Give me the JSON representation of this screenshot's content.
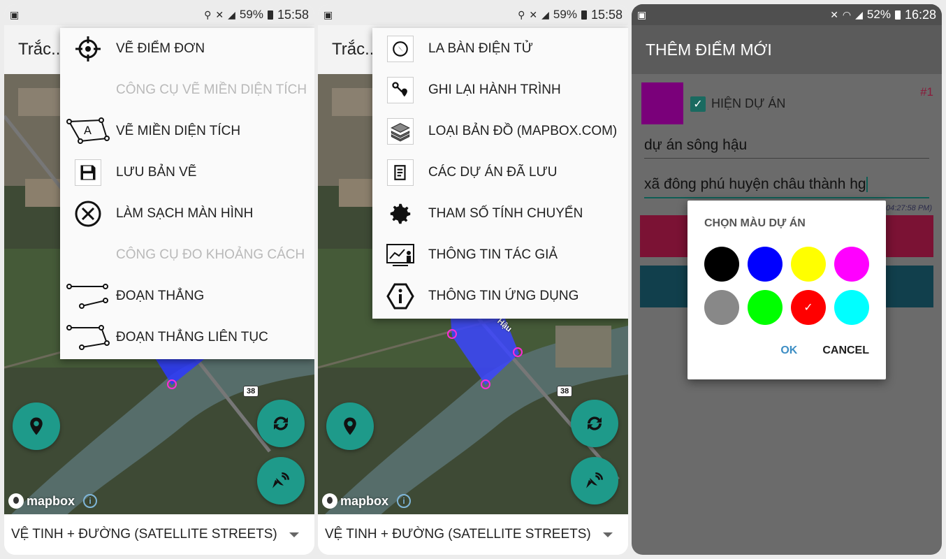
{
  "status": {
    "s1": {
      "battery": "59%",
      "time": "15:58"
    },
    "s2": {
      "battery": "59%",
      "time": "15:58"
    },
    "s3": {
      "battery": "52%",
      "time": "16:28"
    }
  },
  "screen1": {
    "appbar_title": "Trắc...",
    "menu": [
      {
        "label": "VẼ ĐIỂM ĐƠN",
        "icon": "crosshair-icon",
        "disabled": false
      },
      {
        "label": "CÔNG CỤ VẼ MIỀN DIỆN TÍCH",
        "icon": "",
        "disabled": true
      },
      {
        "label": "VẼ MIỀN DIỆN TÍCH",
        "icon": "polygon-area-icon",
        "disabled": false
      },
      {
        "label": "LƯU BẢN VẼ",
        "icon": "floppy-disk-icon",
        "disabled": false
      },
      {
        "label": "LÀM SẠCH MÀN HÌNH",
        "icon": "circle-x-icon",
        "disabled": false
      },
      {
        "label": "CÔNG CỤ ĐO KHOẢNG CÁCH",
        "icon": "",
        "disabled": true
      },
      {
        "label": "ĐOẠN THẲNG",
        "icon": "line-segment-icon",
        "disabled": false
      },
      {
        "label": "ĐOẠN THẲNG LIÊN TỤC",
        "icon": "polyline-icon",
        "disabled": false
      }
    ],
    "road_label": "38",
    "mapbox": "mapbox",
    "info_glyph": "i",
    "map_style": "VỆ TINH + ĐƯỜNG (SATELLITE STREETS)"
  },
  "screen2": {
    "appbar_title": "Trắc...",
    "menu": [
      {
        "label": "LA BÀN ĐIỆN TỬ",
        "icon": "compass-icon"
      },
      {
        "label": "GHI LẠI HÀNH TRÌNH",
        "icon": "route-pin-icon"
      },
      {
        "label": "LOẠI BẢN ĐỒ (MAPBOX.COM)",
        "icon": "layers-icon"
      },
      {
        "label": "CÁC DỰ ÁN ĐÃ LƯU",
        "icon": "notepad-icon"
      },
      {
        "label": "THAM SỐ TÍNH CHUYỂN",
        "icon": "gear-icon"
      },
      {
        "label": "THÔNG TIN TÁC GIẢ",
        "icon": "presenter-icon"
      },
      {
        "label": "THÔNG TIN ỨNG DỤNG",
        "icon": "info-hexagon-icon"
      }
    ],
    "street_label": "Hậu",
    "road_label": "38",
    "mapbox": "mapbox",
    "info_glyph": "i",
    "map_style": "VỆ TINH + ĐƯỜNG (SATELLITE STREETS)"
  },
  "screen3": {
    "appbar_title": "THÊM ĐIỂM MỚI",
    "show_project_label": "HIỆN DỰ ÁN",
    "show_project_checked": true,
    "number_label": "#1",
    "project_name": "dự án sông hậu",
    "address": "xã đông phú huyện châu thành hg",
    "timestamp": "04:27:58 PM)",
    "dialog": {
      "title": "CHỌN MÀU DỰ ÁN",
      "colors": [
        "#000000",
        "#0000ff",
        "#ffff00",
        "#ff00ff",
        "#888888",
        "#00ff00",
        "#ff0000",
        "#00ffff"
      ],
      "selected_index": 6,
      "ok": "OK",
      "cancel": "CANCEL"
    },
    "swatch_color": "#7a007a"
  }
}
